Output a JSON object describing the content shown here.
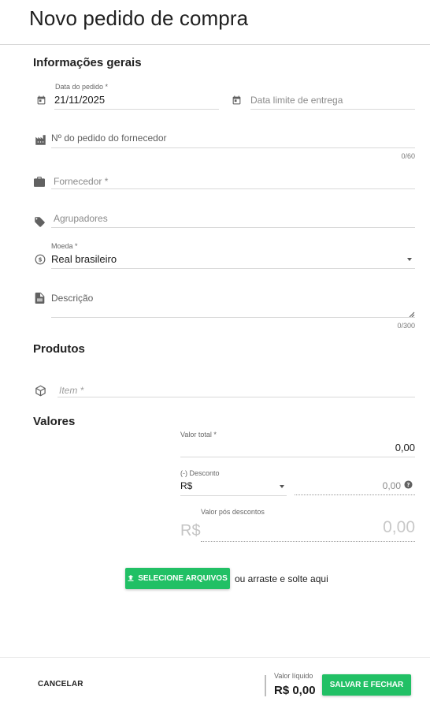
{
  "header": {
    "title": "Novo pedido de compra"
  },
  "general": {
    "section_title": "Informações gerais",
    "order_date": {
      "label": "Data do pedido *",
      "value": "21/11/2025",
      "icon": "calendar-icon"
    },
    "due_date": {
      "placeholder": "Data limite de entrega",
      "icon": "calendar-icon"
    },
    "supplier_order": {
      "placeholder": "Nº do pedido do fornecedor",
      "counter": "0/60",
      "icon": "factory-icon"
    },
    "supplier": {
      "placeholder": "Fornecedor *",
      "icon": "briefcase-icon"
    },
    "groupers": {
      "placeholder": "Agrupadores",
      "icon": "tag-icon"
    },
    "currency": {
      "label": "Moeda *",
      "value": "Real brasileiro",
      "icon": "currency-icon"
    },
    "description": {
      "placeholder": "Descrição",
      "counter": "0/300",
      "icon": "document-icon"
    }
  },
  "products": {
    "section_title": "Produtos",
    "item": {
      "placeholder": "Item *",
      "icon": "cube-icon"
    }
  },
  "values": {
    "section_title": "Valores",
    "total": {
      "label": "Valor total *",
      "value": "0,00"
    },
    "discount": {
      "label": "(-) Desconto",
      "type_value": "R$",
      "amount": "0,00"
    },
    "after_discount": {
      "label": "Valor pós descontos",
      "prefix": "R$",
      "value": "0,00"
    }
  },
  "upload": {
    "button_label": "SELECIONE ARQUIVOS",
    "hint": "ou arraste e solte aqui"
  },
  "footer": {
    "cancel_label": "CANCELAR",
    "net_label": "Valor líquido",
    "net_value": "R$ 0,00",
    "save_label": "SALVAR E FECHAR"
  },
  "colors": {
    "accent": "#21c065",
    "text": "#212121",
    "muted": "#8a8a8a"
  }
}
